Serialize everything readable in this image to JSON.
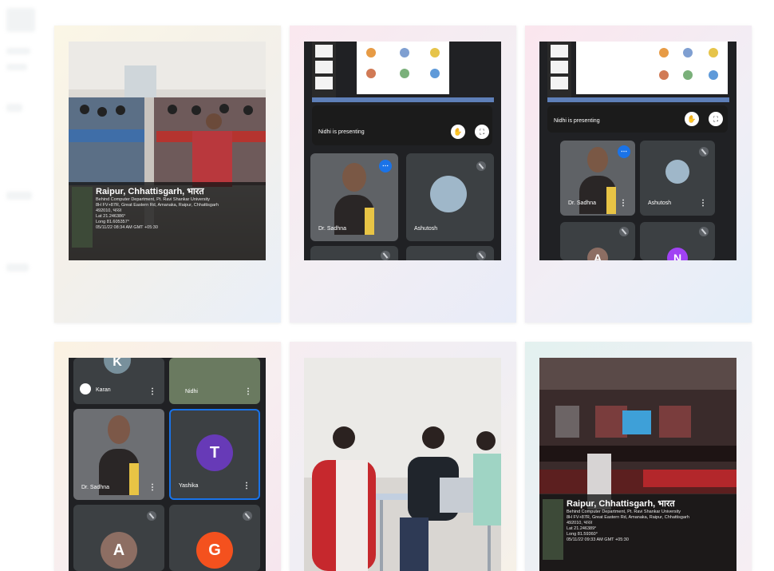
{
  "cards": {
    "c1": {
      "geotag": {
        "place": "Raipur, Chhattisgarh, भारत",
        "line1": "Behind Computer Department, Pt. Ravi Shankar University",
        "line2": "8H FV+87R, Great Eastern Rd, Amanaka, Raipur, Chhattisgarh",
        "line3": "492010, भारत",
        "lat": "Lat 21.246386°",
        "long": "Long 81.605357°",
        "time": "05/11/22 08:34 AM GMT +05:30"
      }
    },
    "c2": {
      "presenting": "Nidhi is presenting",
      "tiles": [
        "Dr. Sadhna",
        "Ashutosh"
      ]
    },
    "c3": {
      "presenting": "Nidhi is presenting",
      "tiles": [
        "Dr. Sadhna",
        "Ashutosh"
      ],
      "avatars": [
        "A",
        "N"
      ]
    },
    "c4": {
      "tiles": [
        "Karan",
        "Nidhi",
        "Dr. Sadhna",
        "Yashika"
      ],
      "avatars": [
        "K",
        "T",
        "A",
        "G"
      ]
    },
    "c6": {
      "geotag": {
        "place": "Raipur, Chhattisgarh, भारत",
        "line1": "Behind Computer Department, Pt. Ravi Shankar University",
        "line2": "8H FV+87R, Great Eastern Rd, Amanaka, Raipur, Chhattisgarh",
        "line3": "492010, भारत",
        "lat": "Lat 21.246389°",
        "long": "Long 81.59360°",
        "time": "05/11/22 09:33 AM GMT +05:30"
      }
    }
  }
}
